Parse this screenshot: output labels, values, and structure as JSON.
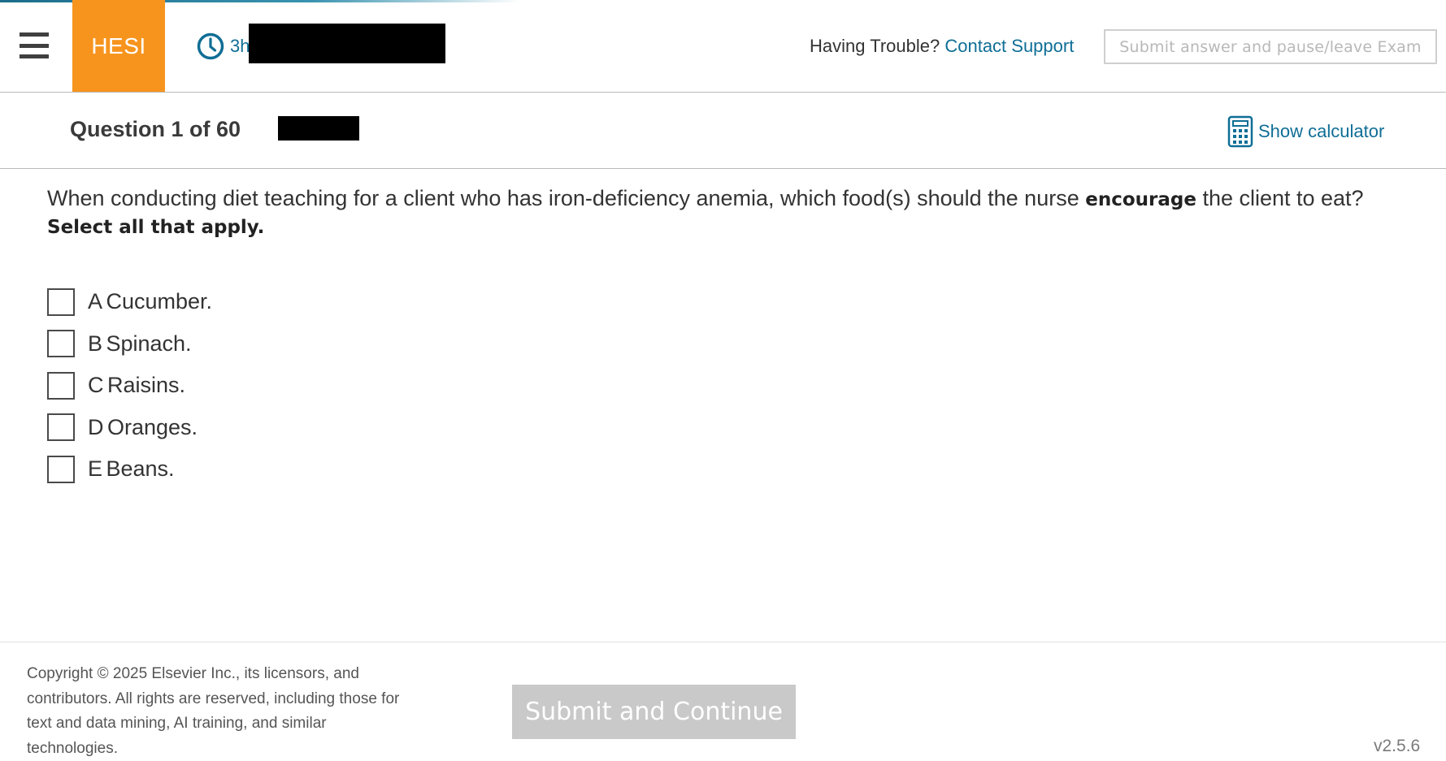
{
  "header": {
    "menu_icon": "hamburger-menu-icon",
    "logo": "HESI",
    "timer_icon": "clock-icon",
    "timer_prefix": "3h",
    "help_text": "Having Trouble?",
    "support_link": "Contact Support",
    "pause_button": "Submit answer and pause/leave Exam"
  },
  "subheader": {
    "question_counter": "Question 1 of 60",
    "calculator_icon": "calculator-icon",
    "calculator_link": "Show calculator"
  },
  "question": {
    "stem_part1": "When conducting diet teaching for a client who has iron-deficiency anemia, which food(s) should the nurse ",
    "stem_emphasis": "encourage",
    "stem_part2": " the client to eat? ",
    "stem_instruction": "Select all that apply.",
    "options": [
      {
        "letter": "A",
        "text": "Cucumber.",
        "checked": false
      },
      {
        "letter": "B",
        "text": "Spinach.",
        "checked": false
      },
      {
        "letter": "C",
        "text": "Raisins.",
        "checked": false
      },
      {
        "letter": "D",
        "text": "Oranges.",
        "checked": false
      },
      {
        "letter": "E",
        "text": "Beans.",
        "checked": false
      }
    ]
  },
  "footer": {
    "copyright": "Copyright © 2025 Elsevier Inc., its licensors, and contributors. All rights are reserved, including those for text and data mining, AI training, and similar technologies.",
    "submit_button": "Submit and Continue",
    "version": "v2.5.6"
  },
  "colors": {
    "brand_orange": "#f7941d",
    "link_blue": "#0f6e96",
    "disabled_gray": "#c9c9c9"
  }
}
